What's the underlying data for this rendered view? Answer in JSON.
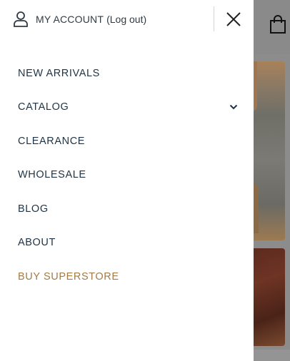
{
  "header": {
    "account_label": "MY ACCOUNT",
    "logout_label": "(Log out)"
  },
  "menu": {
    "items": [
      {
        "label": "NEW ARRIVALS"
      },
      {
        "label": "CATALOG"
      },
      {
        "label": "CLEARANCE"
      },
      {
        "label": "WHOLESALE"
      },
      {
        "label": "BLOG"
      },
      {
        "label": "ABOUT"
      },
      {
        "label": "BUY SUPERSTORE"
      }
    ]
  },
  "colors": {
    "text": "#1f3344",
    "accent": "#a27b45",
    "overlay": "#8c8c8c"
  },
  "icons": {
    "account": "user-icon",
    "close": "close-icon",
    "cart": "shopping-bag-icon",
    "expand": "chevron-down-icon"
  }
}
